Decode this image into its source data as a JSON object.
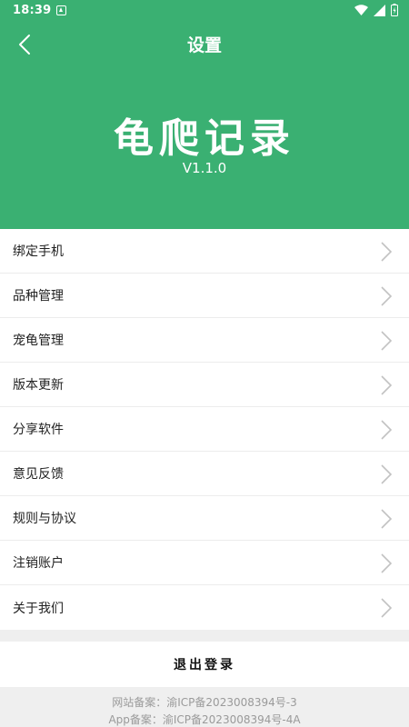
{
  "status_bar": {
    "time": "18:39"
  },
  "header": {
    "title": "设置",
    "app_name": "龟爬记录",
    "version": "V1.1.0"
  },
  "menu": {
    "items": [
      {
        "label": "绑定手机"
      },
      {
        "label": "品种管理"
      },
      {
        "label": "宠龟管理"
      },
      {
        "label": "版本更新"
      },
      {
        "label": "分享软件"
      },
      {
        "label": "意见反馈"
      },
      {
        "label": "规则与协议"
      },
      {
        "label": "注销账户"
      },
      {
        "label": "关于我们"
      }
    ]
  },
  "logout": {
    "label": "退出登录"
  },
  "footer": {
    "website_record": "网站备案：渝ICP备2023008394号-3",
    "app_record": "App备案：渝ICP备2023008394号-4A"
  },
  "colors": {
    "primary": "#3ab072",
    "background": "#efefef"
  }
}
